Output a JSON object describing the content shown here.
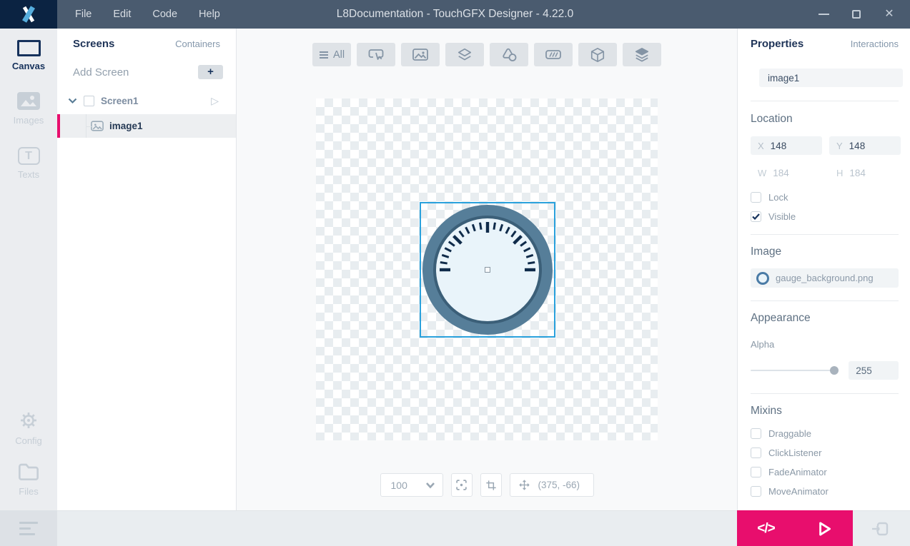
{
  "window": {
    "title": "L8Documentation - TouchGFX Designer - 4.22.0",
    "menus": [
      "File",
      "Edit",
      "Code",
      "Help"
    ],
    "close_glyph": "✕"
  },
  "sidebar": {
    "canvas_label": "Canvas",
    "images_label": "Images",
    "texts_label": "Texts",
    "texts_icon_glyph": "T",
    "config_label": "Config",
    "files_label": "Files"
  },
  "screens_panel": {
    "tab_screens": "Screens",
    "tab_containers": "Containers",
    "add_screen_label": "Add Screen",
    "add_button_glyph": "+",
    "screen_name": "Screen1",
    "widget_name": "image1",
    "play_glyph": "▷"
  },
  "canvas": {
    "toolbar_all_label": "All",
    "zoom_value": "100",
    "position_readout": "(375, -66)"
  },
  "properties": {
    "tab_properties": "Properties",
    "tab_interactions": "Interactions",
    "name_value": "image1",
    "location": {
      "header": "Location",
      "x_label": "X",
      "x_value": "148",
      "y_label": "Y",
      "y_value": "148",
      "w_label": "W",
      "w_value": "184",
      "h_label": "H",
      "h_value": "184",
      "lock_label": "Lock",
      "visible_label": "Visible"
    },
    "image": {
      "header": "Image",
      "filename": "gauge_background.png"
    },
    "appearance": {
      "header": "Appearance",
      "alpha_label": "Alpha",
      "alpha_value": "255"
    },
    "mixins": {
      "header": "Mixins",
      "items": [
        "Draggable",
        "ClickListener",
        "FadeAnimator",
        "MoveAnimator"
      ]
    }
  },
  "footer": {
    "code_glyph": "</>"
  },
  "colors": {
    "accent_pink": "#e80e6d",
    "selection_blue": "#2aa1dc",
    "navy": "#16325c",
    "titlebar": "#4a5b6f",
    "logo_bg": "#0b2342",
    "gauge_ring": "#567e99",
    "gauge_face": "#e9f4fa",
    "gauge_tick": "#0f2b4a"
  }
}
